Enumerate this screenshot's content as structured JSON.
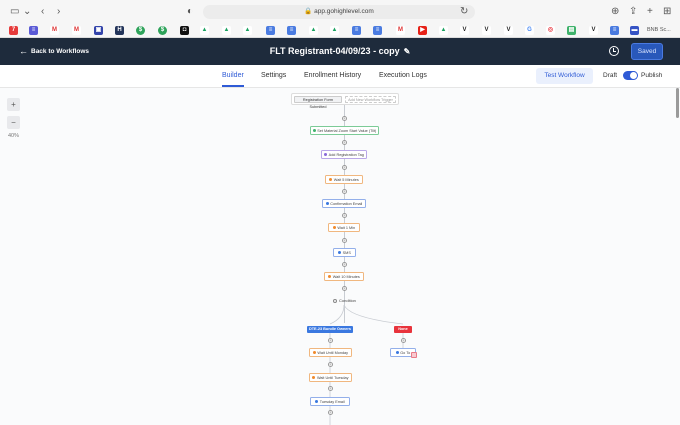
{
  "browser": {
    "url": "app.gohighlevel.com",
    "bookmark_overflow": "BNB Sc..."
  },
  "header": {
    "back_label": "Back to Workflows",
    "title": "FLT Registrant-04/09/23 - copy",
    "saved_label": "Saved"
  },
  "tabs": [
    {
      "label": "Builder",
      "active": true
    },
    {
      "label": "Settings"
    },
    {
      "label": "Enrollment History"
    },
    {
      "label": "Execution Logs"
    }
  ],
  "actions": {
    "test_workflow": "Test Workflow",
    "draft_label": "Draft",
    "publish_label": "Publish",
    "publish_on": true
  },
  "zoom": {
    "plus": "+",
    "minus": "−",
    "level": "40%"
  },
  "triggers": [
    {
      "label": "Registration Form Submitted"
    },
    {
      "label": "Add New Workflow Trigger"
    }
  ],
  "flow": {
    "steps": [
      {
        "label": "Set Material Zoom Start Value (Tilt)",
        "type": "green"
      },
      {
        "label": "Add Registration Tag",
        "type": "purple"
      },
      {
        "label": "Wait 5 Minutes",
        "type": "orange"
      },
      {
        "label": "Confirmation Email",
        "type": "blue"
      },
      {
        "label": "Wait 1 Min",
        "type": "orange"
      },
      {
        "label": "SMS",
        "type": "blue"
      },
      {
        "label": "Wait 10 Minutes",
        "type": "orange"
      }
    ],
    "condition_label": "Condition",
    "branch_yes": "DTE-23 Bundle Owners",
    "branch_no": "None",
    "left_steps": [
      {
        "label": "Wait Until Monday",
        "type": "orange"
      },
      {
        "label": "Wait Until Tuesday",
        "type": "orange"
      },
      {
        "label": "Tuesday Email",
        "type": "blue"
      }
    ],
    "right_step": {
      "label": "Go To",
      "type": "blue"
    }
  },
  "colors": {
    "header_bg": "#1e2b3c",
    "accent": "#2f5bd6",
    "branch_yes": "#3a78e0",
    "branch_no": "#e8333c"
  }
}
